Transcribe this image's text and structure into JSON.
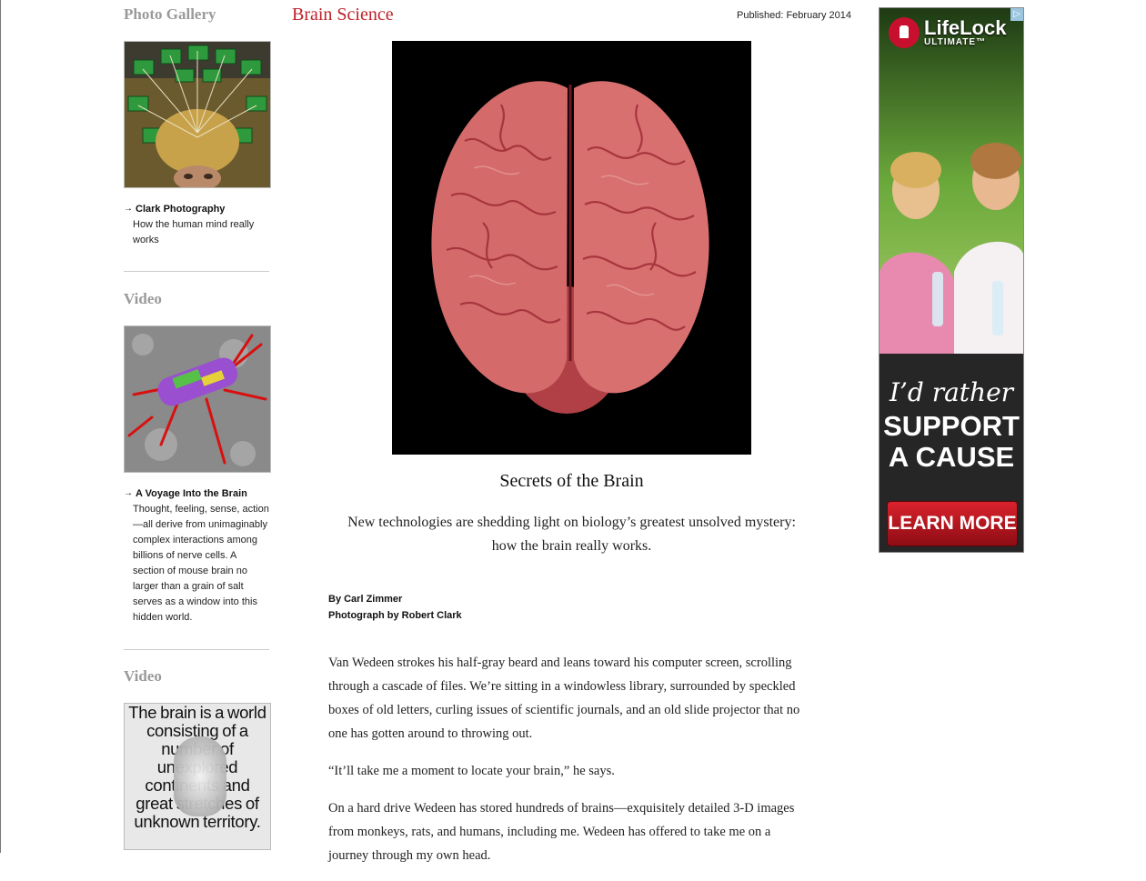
{
  "sidebar": {
    "sections": [
      {
        "heading": "Photo Gallery",
        "item_title": "Clark Photography",
        "item_desc": "How the human mind really works"
      },
      {
        "heading": "Video",
        "item_title": "A Voyage Into the Brain",
        "item_desc": "Thought, feeling, sense, action—all derive from unimaginably complex interactions among billions of nerve cells. A section of mouse brain no larger than a grain of salt serves as a window into this hidden world."
      },
      {
        "heading": "Video",
        "thumb_text": "The brain is a world consisting of a number of unexplored continents and great stretches of unknown territory."
      }
    ]
  },
  "article": {
    "section_label": "Brain Science",
    "published": "Published: February 2014",
    "headline": "Secrets of the Brain",
    "deck": "New technologies are shedding light on biology’s greatest unsolved mystery: how the brain really works.",
    "byline": "By Carl Zimmer",
    "photo_credit": "Photograph by Robert Clark",
    "paragraphs": [
      "Van Wedeen strokes his half-gray beard and leans toward his computer screen, scrolling through a cascade of files. We’re sitting in a windowless library, surrounded by speckled boxes of old letters, curling issues of scientific journals, and an old slide projector that no one has gotten around to throwing out.",
      "“It’ll take me a moment to locate your brain,” he says.",
      "On a hard drive Wedeen has stored hundreds of brains—exquisitely detailed 3-D images from monkeys, rats, and humans, including me. Wedeen has offered to take me on a journey through my own head."
    ]
  },
  "ad": {
    "brand": "LifeLock",
    "tier": "ULTIMATE™",
    "tagline_1": "I’d rather",
    "tagline_2": "SUPPORT A CAUSE",
    "cta": "LEARN MORE",
    "adchoices": "▷"
  },
  "colors": {
    "section_red": "#c0202a",
    "heading_gray": "#9a9a9a",
    "ad_red": "#c8102e"
  }
}
